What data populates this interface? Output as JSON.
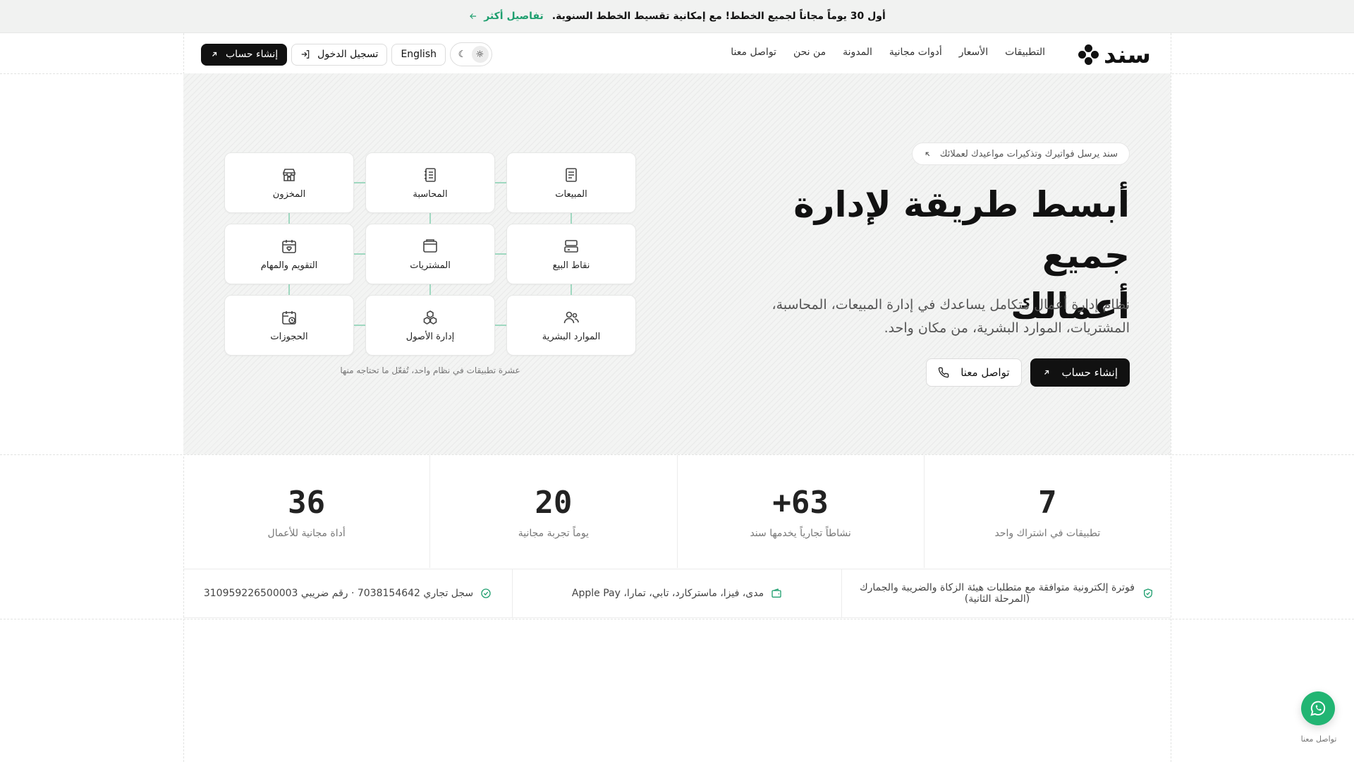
{
  "announcement": {
    "text": "أول 30 يوماً مجاناً لجميع الخطط! مع إمكانية تقسيط الخطط السنوية.",
    "link_label": "تفاصيل أكثر"
  },
  "brand": {
    "name": "سند"
  },
  "nav": {
    "links": [
      "التطبيقات",
      "الأسعار",
      "أدوات مجانية",
      "المدونة",
      "من نحن",
      "تواصل معنا"
    ],
    "language_label": "English",
    "login_label": "تسجيل الدخول",
    "signup_label": "إنشاء حساب"
  },
  "hero": {
    "badge": "سند يرسل فواتيرك وتذكيرات مواعيدك لعملائك",
    "title_line1": "أبسط طريقة لإدارة جميع",
    "title_line2": "أعمالك",
    "subtitle": "نظام إدارة أعمال متكامل يساعدك في إدارة المبيعات، المحاسبة، المشتريات، الموارد البشرية، من مكان واحد.",
    "primary_cta": "إنشاء حساب",
    "secondary_cta": "تواصل معنا"
  },
  "apps": {
    "items": [
      {
        "label": "المبيعات",
        "icon": "receipt-icon"
      },
      {
        "label": "المحاسبة",
        "icon": "ledger-icon"
      },
      {
        "label": "المخزون",
        "icon": "store-icon"
      },
      {
        "label": "نقاط البيع",
        "icon": "pos-icon"
      },
      {
        "label": "المشتريات",
        "icon": "wallet-icon"
      },
      {
        "label": "التقويم والمهام",
        "icon": "calendar-heart-icon"
      },
      {
        "label": "الموارد البشرية",
        "icon": "users-icon"
      },
      {
        "label": "إدارة الأصول",
        "icon": "boxes-icon"
      },
      {
        "label": "الحجوزات",
        "icon": "calendar-clock-icon"
      }
    ],
    "caption": "عشرة تطبيقات في نظام واحد، تُفعّل ما تحتاجه منها"
  },
  "stats": [
    {
      "value": "7",
      "label": "تطبيقات في اشتراك واحد"
    },
    {
      "value": "+63",
      "label": "نشاطاً تجارياً يخدمها سند"
    },
    {
      "value": "20",
      "label": "يوماً تجربة مجانية"
    },
    {
      "value": "36",
      "label": "أداة مجانية للأعمال"
    }
  ],
  "trust": [
    {
      "text": "فوترة إلكترونية متوافقة مع متطلبات هيئة الزكاة والضريبة والجمارك (المرحلة الثانية)",
      "icon": "shield-check-icon"
    },
    {
      "text": "مدى، فيزا، ماستركارد، تابي، تمارا، Apple Pay",
      "icon": "wallet-icon"
    },
    {
      "text": "سجل تجاري 7038154642 · رقم ضريبي 310959226500003",
      "icon": "check-circle-icon"
    }
  ],
  "whatsapp": {
    "label": "تواصل معنا"
  },
  "colors": {
    "accent": "#1f9f6f",
    "dark": "#111111",
    "whatsapp": "#22b573"
  }
}
